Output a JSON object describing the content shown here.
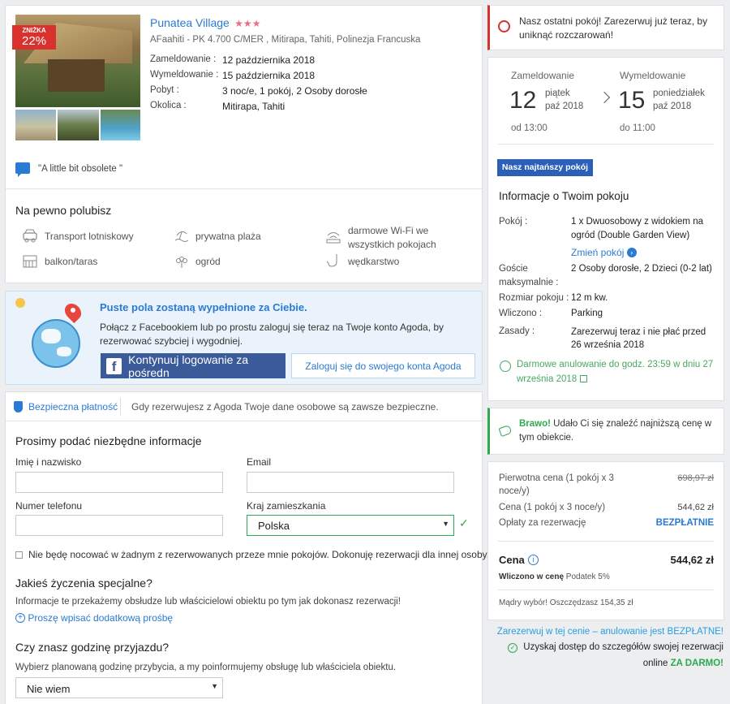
{
  "hotel": {
    "name": "Punatea Village",
    "stars": "★★★",
    "address": "AFaahiti - PK 4.700 C/MER , Mitirapa, Tahiti, Polinezja Francuska",
    "discount_label": "ZNIŻKA",
    "discount_value": "22%",
    "checkin_label": "Zameldowanie :",
    "checkin_value": "12 października 2018",
    "checkout_label": "Wymeldowanie :",
    "checkout_value": "15 października 2018",
    "stay_label": "Pobyt :",
    "stay_value": "3 noc/e, 1 pokój, 2 Osoby dorosłe",
    "area_label": "Okolica :",
    "area_value": "Mitirapa, Tahiti",
    "review_quote": "\"A little bit obsolete \""
  },
  "amenities": {
    "title": "Na pewno polubisz",
    "items": [
      "Transport lotniskowy",
      "prywatna plaża",
      "darmowe Wi-Fi we",
      "wszystkich pokojach",
      "balkon/taras",
      "ogród",
      "wędkarstwo"
    ]
  },
  "login_promo": {
    "title": "Puste pola zostaną wypełnione za Ciebie.",
    "text1": "Połącz z Facebookiem lub po prostu zaloguj się teraz na Twoje konto Agoda, by",
    "text2": "rezerwować szybciej i wygodniej.",
    "facebook_button": "Kontynuuj logowanie za pośredn",
    "agoda_button": "Zaloguj się do swojego konta Agoda"
  },
  "secure": {
    "label": "Bezpieczna płatność",
    "text": "Gdy rezerwujesz z Agoda Twoje dane osobowe są zawsze bezpieczne."
  },
  "form": {
    "title": "Prosimy podać niezbędne informacje",
    "name_label": "Imię i nazwisko",
    "email_label": "Email",
    "phone_label": "Numer telefonu",
    "country_label": "Kraj zamieszkania",
    "country_value": "Polska",
    "not_staying_label": "Nie będę nocować w żadnym z rezerwowanych przeze mnie pokojów. Dokonuję rezerwacji dla innej osoby.",
    "special_title": "Jakieś życzenia specjalne?",
    "special_text": "Informacje te przekażemy obsłudze lub właścicielowi obiektu po tym jak dokonasz rezerwacji!",
    "special_link": "Proszę wpisać dodatkową prośbę",
    "arrival_title": "Czy znasz godzinę przyjazdu?",
    "arrival_text": "Wybierz planowaną godzinę przybycia, a my poinformujemy obsługę lub właściciela obiektu.",
    "arrival_value": "Nie wiem"
  },
  "last_room": {
    "text1": "Nasz ostatni pokój! Zarezerwuj już teraz, by",
    "text2": "uniknąć rozczarowań!"
  },
  "dates": {
    "checkin_label": "Zameldowanie",
    "checkin_day": "12",
    "checkin_weekday": "piątek",
    "checkin_month": "paź 2018",
    "checkin_time": "od 13:00",
    "checkout_label": "Wymeldowanie",
    "checkout_day": "15",
    "checkout_weekday": "poniedziałek",
    "checkout_month": "paź 2018",
    "checkout_time": "do 11:00"
  },
  "room": {
    "badge": "Nasz najtańszy pokój",
    "title": "Informacje o Twoim pokoju",
    "room_label": "Pokój :",
    "room_value1": "1 x Dwuosobowy z widokiem na",
    "room_value2": "ogród (Double Garden View)",
    "change_room": "Zmień pokój",
    "guests_label1": "Goście",
    "guests_label2": "maksymalnie :",
    "guests_value": "2 Osoby dorosłe, 2 Dzieci (0-2 lat)",
    "size_label": "Rozmiar pokoju :",
    "size_value": "12 m kw.",
    "included_label": "Wliczono :",
    "included_value": "Parking",
    "rules_label": "Zasady :",
    "rules_value1": "Zarezerwuj teraz i nie płać przed",
    "rules_value2": "26 września 2018",
    "cancel1": "Darmowe anulowanie do godz. 23:59 w dniu 27",
    "cancel2": "września 2018"
  },
  "bravo": {
    "strong": "Brawo!",
    "text1": " Udało Ci się znaleźć najniższą cenę w",
    "text2": "tym obiekcie."
  },
  "price": {
    "original_label1": "Pierwotna cena (1 pokój x 3",
    "original_label2": "noce/y)",
    "original_value": "698,97 zł",
    "price_label": "Cena (1 pokój x 3 noce/y)",
    "price_value": "544,62 zł",
    "fee_label": "Opłaty za rezerwację",
    "fee_value": "BEZPŁATNIE",
    "total_label": "Cena",
    "total_value": "544,62 zł",
    "tax_included": "Wliczono w cenę",
    "tax_text": "Podatek 5%",
    "savings": "Mądry wybór! Oszczędzasz 154,35 zł"
  },
  "footer": {
    "cancel_note": "Zarezerwuj w tej cenie – anulowanie jest BEZPŁATNE!",
    "access1": "Uzyskaj dostęp do szczegółów swojej rezerwacji",
    "access2": "online ",
    "access_free": "ZA DARMO!"
  },
  "colors": {
    "accent": "#2a7ad3",
    "facebook": "#3a5a99",
    "green": "#2fa84f",
    "red": "#d9322e"
  }
}
